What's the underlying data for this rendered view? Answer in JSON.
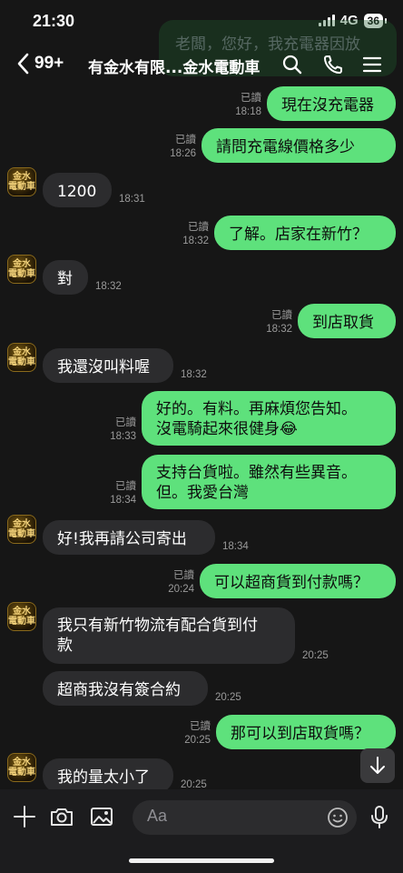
{
  "status_bar": {
    "time": "21:30",
    "network": "4G",
    "battery": "36"
  },
  "ghost_preview": {
    "text": "老闆，您好，我充電器因放"
  },
  "header": {
    "unread_count": "99+",
    "title": "有金水有限...金水電動車"
  },
  "avatar_text": "金水\n電動車",
  "messages": [
    {
      "dir": "out",
      "text": "現在沒充電器",
      "read": "已讀",
      "time": "18:18"
    },
    {
      "dir": "out",
      "text": "請問充電線價格多少",
      "read": "已讀",
      "time": "18:26"
    },
    {
      "dir": "in",
      "text": "1200",
      "time": "18:31"
    },
    {
      "dir": "out",
      "text": "了解。店家在新竹？",
      "read": "已讀",
      "time": "18:32"
    },
    {
      "dir": "in",
      "text": "對",
      "time": "18:32"
    },
    {
      "dir": "out",
      "text": "到店取貨",
      "read": "已讀",
      "time": "18:32"
    },
    {
      "dir": "in",
      "text": "我還沒叫料喔",
      "time": "18:32"
    },
    {
      "dir": "out",
      "text": "好的。有料。再麻煩您告知。\n沒電騎起來很健身😂",
      "read": "已讀",
      "time": "18:33"
    },
    {
      "dir": "out",
      "text": "支持台貨啦。雖然有些異音。\n但。我愛台灣",
      "read": "已讀",
      "time": "18:34"
    },
    {
      "dir": "in",
      "text": "好!我再請公司寄出",
      "time": "18:34"
    },
    {
      "dir": "out",
      "text": "可以超商貨到付款嗎？",
      "read": "已讀",
      "time": "20:24"
    },
    {
      "dir": "in",
      "text": "我只有新竹物流有配合貨到付\n款",
      "time": "20:25"
    },
    {
      "dir": "in",
      "text": "超商我沒有簽合約",
      "time": "20:25"
    },
    {
      "dir": "out",
      "text": "那可以到店取貨嗎？",
      "read": "已讀",
      "time": "20:25"
    },
    {
      "dir": "in",
      "text": "我的量太小了",
      "time": "20:25"
    }
  ],
  "input": {
    "placeholder": "Aa"
  }
}
